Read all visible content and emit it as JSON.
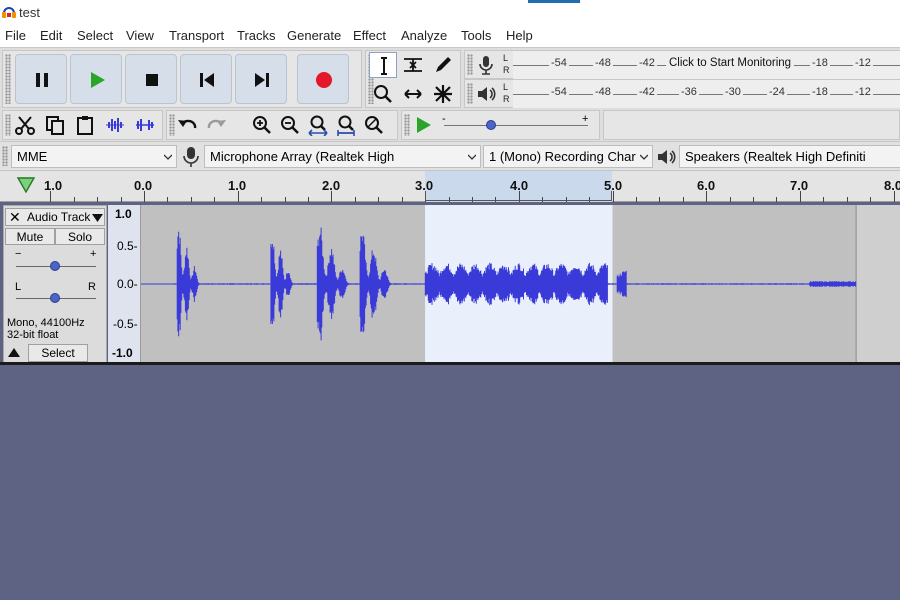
{
  "window": {
    "title": "test"
  },
  "menu": [
    "File",
    "Edit",
    "Select",
    "View",
    "Transport",
    "Tracks",
    "Generate",
    "Effect",
    "Analyze",
    "Tools",
    "Help"
  ],
  "meters": {
    "record": {
      "channels": [
        "L",
        "R"
      ],
      "ticks": [
        "-54",
        "-48",
        "-42",
        "-18",
        "-12"
      ],
      "prompt": "Click to Start Monitoring"
    },
    "playback": {
      "channels": [
        "L",
        "R"
      ],
      "ticks": [
        "-54",
        "-48",
        "-42",
        "-36",
        "-30",
        "-24",
        "-18",
        "-12"
      ]
    }
  },
  "devices": {
    "host": "MME",
    "recording_device": "Microphone Array (Realtek High",
    "recording_channels": "1 (Mono) Recording Char",
    "playback_device": "Speakers (Realtek High Definiti"
  },
  "timeline": {
    "labels": [
      "1.0",
      "0.0",
      "1.0",
      "2.0",
      "3.0",
      "4.0",
      "5.0",
      "6.0",
      "7.0",
      "8.0"
    ],
    "selection_start": 3.0,
    "selection_end": 5.0
  },
  "play_speed": {
    "min": "-",
    "max": "+"
  },
  "track": {
    "name": "Audio Track",
    "mute_label": "Mute",
    "solo_label": "Solo",
    "gain_min": "−",
    "gain_max": "+",
    "pan_left": "L",
    "pan_right": "R",
    "format": "Mono, 44100Hz",
    "bit_depth": "32-bit float",
    "select_label": "Select",
    "amplitude_labels": [
      "1.0",
      "0.5-",
      "0.0-",
      "-0.5-",
      "-1.0"
    ],
    "clip_end_seconds": 7.6
  },
  "colors": {
    "waveform": "#3a3ad8",
    "selection": "#eaf0fb",
    "background": "#5e6283",
    "record": "#e4172b",
    "play": "#2aa52a"
  },
  "icons": [
    "audacity-icon",
    "pause-icon",
    "play-icon",
    "stop-icon",
    "skip-start-icon",
    "skip-end-icon",
    "record-icon",
    "selection-tool-icon",
    "envelope-tool-icon",
    "draw-tool-icon",
    "zoom-tool-icon",
    "time-shift-tool-icon",
    "multi-tool-icon",
    "microphone-icon",
    "speaker-icon",
    "cut-icon",
    "copy-icon",
    "paste-icon",
    "trim-icon",
    "silence-icon",
    "undo-icon",
    "redo-icon",
    "zoom-in-icon",
    "zoom-out-icon",
    "fit-selection-icon",
    "fit-project-icon",
    "zoom-toggle-icon"
  ]
}
